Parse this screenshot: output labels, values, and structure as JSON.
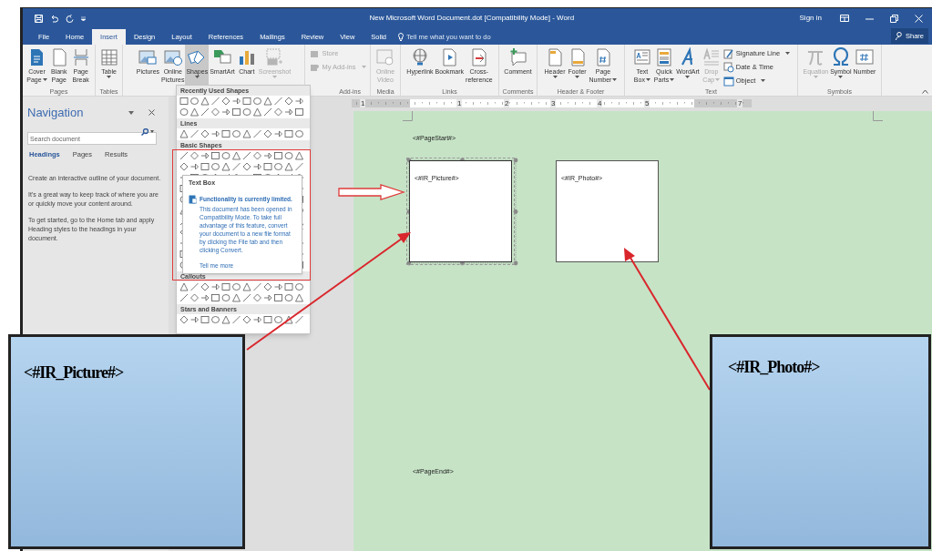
{
  "title_bar": {
    "title": "New Microsoft Word Document.dot [Compatibility Mode] - Word",
    "sign_in": "Sign in"
  },
  "ribbon_tabs": [
    {
      "label": "File",
      "selected": false
    },
    {
      "label": "Home",
      "selected": false
    },
    {
      "label": "Insert",
      "selected": true
    },
    {
      "label": "Design",
      "selected": false
    },
    {
      "label": "Layout",
      "selected": false
    },
    {
      "label": "References",
      "selected": false
    },
    {
      "label": "Mailings",
      "selected": false
    },
    {
      "label": "Review",
      "selected": false
    },
    {
      "label": "View",
      "selected": false
    },
    {
      "label": "Solid",
      "selected": false
    }
  ],
  "tell_me": {
    "placeholder": "Tell me what you want to do"
  },
  "share": "Share",
  "ribbon_groups": [
    {
      "label": "Pages",
      "buttons": [
        {
          "kind": "large",
          "lines": [
            "Cover",
            "Page"
          ],
          "dropdown": true,
          "disabled": false,
          "pressed": false
        },
        {
          "kind": "large",
          "lines": [
            "Blank",
            "Page"
          ],
          "dropdown": false,
          "disabled": false,
          "pressed": false
        },
        {
          "kind": "large",
          "lines": [
            "Page",
            "Break"
          ],
          "dropdown": false,
          "disabled": false,
          "pressed": false
        }
      ]
    },
    {
      "label": "Tables",
      "buttons": [
        {
          "kind": "large",
          "lines": [
            "Table"
          ],
          "dropdown": true,
          "disabled": false,
          "pressed": false
        }
      ]
    },
    {
      "buttons": [
        {
          "kind": "large",
          "lines": [
            "Pictures"
          ],
          "dropdown": false,
          "disabled": false,
          "pressed": false
        },
        {
          "kind": "large",
          "lines": [
            "Online",
            "Pictures"
          ],
          "dropdown": false,
          "disabled": false,
          "pressed": false
        },
        {
          "kind": "large",
          "lines": [
            "Shapes"
          ],
          "dropdown": true,
          "disabled": false,
          "pressed": true
        },
        {
          "kind": "large",
          "lines": [
            "SmartArt"
          ],
          "dropdown": false,
          "disabled": false,
          "pressed": false
        },
        {
          "kind": "large",
          "lines": [
            "Chart"
          ],
          "dropdown": false,
          "disabled": false,
          "pressed": false
        },
        {
          "kind": "large",
          "lines": [
            "Screenshot"
          ],
          "dropdown": true,
          "disabled": true,
          "pressed": false
        }
      ]
    },
    {
      "label": "Add-ins",
      "buttons": [
        {
          "kind": "small",
          "lines": [
            "Store"
          ],
          "dropdown": false,
          "disabled": true,
          "pressed": false
        },
        {
          "kind": "small",
          "lines": [
            "My Add-ins"
          ],
          "dropdown": true,
          "disabled": true,
          "pressed": false
        }
      ]
    },
    {
      "label": "Media",
      "buttons": [
        {
          "kind": "large",
          "lines": [
            "Online",
            "Video"
          ],
          "dropdown": false,
          "disabled": true,
          "pressed": false
        }
      ]
    },
    {
      "label": "Links",
      "buttons": [
        {
          "kind": "large",
          "lines": [
            "Hyperlink"
          ],
          "dropdown": false,
          "disabled": false,
          "pressed": false
        },
        {
          "kind": "large",
          "lines": [
            "Bookmark"
          ],
          "dropdown": false,
          "disabled": false,
          "pressed": false
        },
        {
          "kind": "large",
          "lines": [
            "Cross-",
            "reference"
          ],
          "dropdown": false,
          "disabled": false,
          "pressed": false
        }
      ]
    },
    {
      "label": "Comments",
      "buttons": [
        {
          "kind": "large",
          "lines": [
            "Comment"
          ],
          "dropdown": false,
          "disabled": false,
          "pressed": false
        }
      ]
    },
    {
      "label": "Header & Footer",
      "buttons": [
        {
          "kind": "large",
          "lines": [
            "Header"
          ],
          "dropdown": true,
          "disabled": false,
          "pressed": false
        },
        {
          "kind": "large",
          "lines": [
            "Footer"
          ],
          "dropdown": true,
          "disabled": false,
          "pressed": false
        },
        {
          "kind": "large",
          "lines": [
            "Page",
            "Number"
          ],
          "dropdown": true,
          "disabled": false,
          "pressed": false
        }
      ]
    },
    {
      "label": "Text",
      "buttons": [
        {
          "kind": "large",
          "lines": [
            "Text",
            "Box"
          ],
          "dropdown": true,
          "disabled": false,
          "pressed": false
        },
        {
          "kind": "large",
          "lines": [
            "Quick",
            "Parts"
          ],
          "dropdown": true,
          "disabled": false,
          "pressed": false
        },
        {
          "kind": "large",
          "lines": [
            "WordArt"
          ],
          "dropdown": true,
          "disabled": false,
          "pressed": false
        },
        {
          "kind": "large",
          "lines": [
            "Drop",
            "Cap"
          ],
          "dropdown": true,
          "disabled": true,
          "pressed": false
        },
        {
          "kind": "small",
          "lines": [
            "Signature Line"
          ],
          "dropdown": true,
          "disabled": false,
          "pressed": false
        },
        {
          "kind": "small",
          "lines": [
            "Date & Time"
          ],
          "dropdown": false,
          "disabled": false,
          "pressed": false
        },
        {
          "kind": "small",
          "lines": [
            "Object"
          ],
          "dropdown": true,
          "disabled": false,
          "pressed": false
        }
      ]
    },
    {
      "label": "Symbols",
      "buttons": [
        {
          "kind": "large",
          "lines": [
            "Equation"
          ],
          "dropdown": true,
          "disabled": true,
          "pressed": false
        },
        {
          "kind": "large",
          "lines": [
            "Symbol"
          ],
          "dropdown": true,
          "disabled": false,
          "pressed": false
        },
        {
          "kind": "large",
          "lines": [
            "Number"
          ],
          "dropdown": false,
          "disabled": false,
          "pressed": false
        }
      ]
    }
  ],
  "navigation": {
    "title": "Navigation",
    "search": {
      "placeholder": "Search document"
    },
    "tabs": [
      {
        "label": "Headings",
        "selected": true
      },
      {
        "label": "Pages",
        "selected": false
      },
      {
        "label": "Results",
        "selected": false
      }
    ],
    "paragraphs": [
      "Create an interactive outline of your document.",
      "It's a great way to keep track of where you are or quickly move your content around.",
      "To get started, go to the Home tab and apply Heading styles to the headings in your document."
    ]
  },
  "ruler": {
    "labels": [
      "1",
      "1",
      "2",
      "3",
      "4",
      "5",
      "7"
    ]
  },
  "document": {
    "page_start": "<#PageStart#>",
    "text_boxes": [
      {
        "text": "<#IR_Picture#>",
        "selected": true
      },
      {
        "text": "<#IR_Photo#>",
        "selected": false
      }
    ],
    "page_end": "<#PageEnd#>"
  },
  "shapes_menu": {
    "sections": [
      {
        "title": "Recently Used Shapes"
      },
      {
        "title": "Lines"
      },
      {
        "title": "Basic Shapes"
      },
      {
        "title": "Callouts"
      },
      {
        "title": "Stars and Banners"
      }
    ]
  },
  "tooltip": {
    "title": "Text Box",
    "heading": "Functionality is currently limited.",
    "body": "This document has been opened in Compatibility Mode. To take full advantage of this feature, convert your document to a new file format by clicking the File tab and then clicking Convert.",
    "link": "Tell me more"
  },
  "callouts": [
    {
      "text": "<#IR_Picture#>"
    },
    {
      "text": "<#IR_Photo#>"
    }
  ]
}
